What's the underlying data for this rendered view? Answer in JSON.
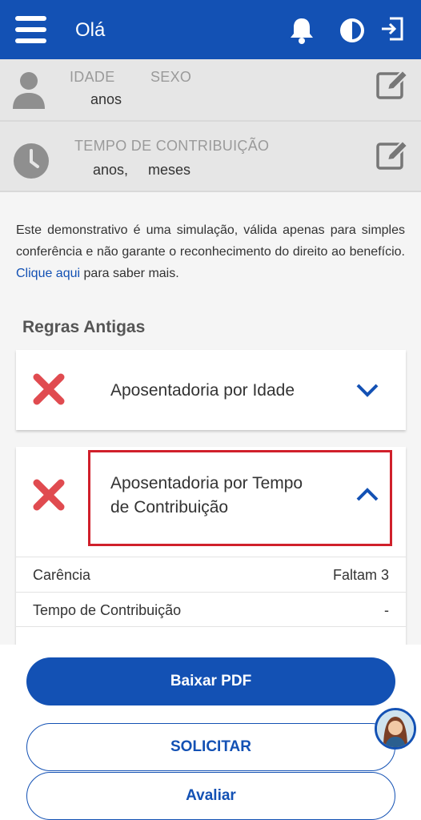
{
  "header": {
    "title": "Olá",
    "menu_icon": "hamburger-icon",
    "bell_icon": "bell-icon",
    "contrast_icon": "contrast-icon",
    "logout_icon": "logout-icon"
  },
  "profile": {
    "age_label": "IDADE",
    "sex_label": "SEXO",
    "age_value": "anos"
  },
  "contribution": {
    "label": "TEMPO DE CONTRIBUIÇÃO",
    "years": "anos,",
    "months": "meses"
  },
  "disclaimer": {
    "text": "Este demonstrativo é uma simulação, válida apenas para simples conferência e não garante o reconhecimento do direito ao benefício.",
    "link": "Clique aqui",
    "suffix": "para saber mais."
  },
  "section": {
    "title": "Regras Antigas"
  },
  "rules": [
    {
      "title": "Aposentadoria por Idade",
      "status": "not-eligible",
      "expanded": false
    },
    {
      "title_line1": "Aposentadoria por Tempo",
      "title_line2": "de Contribuição",
      "status": "not-eligible",
      "expanded": true
    }
  ],
  "details": [
    {
      "label": "Carência",
      "value": "Faltam 3"
    },
    {
      "label": "Tempo de Contribuição",
      "value": "-"
    }
  ],
  "actions": {
    "download": "Baixar PDF",
    "request": "SOLICITAR",
    "rate": "Avaliar"
  },
  "colors": {
    "primary": "#1351b4",
    "danger": "#e04b50",
    "highlight": "#d0202b"
  }
}
